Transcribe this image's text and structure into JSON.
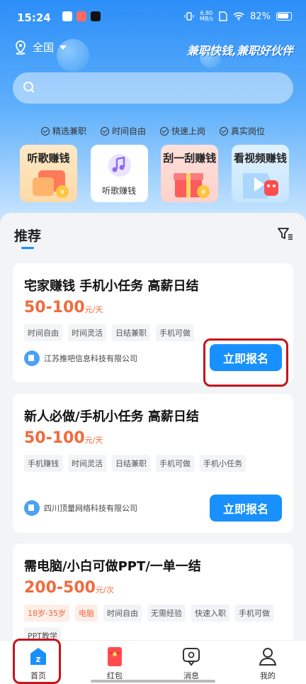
{
  "status_bar": {
    "time": "15:24",
    "speed_value": "6.80",
    "speed_unit": "MB/s",
    "battery": "82%"
  },
  "location": "全国",
  "slogan": "兼职快钱,兼职好伙伴",
  "features": [
    "精选兼职",
    "时间自由",
    "快速上岗",
    "真实岗位"
  ],
  "categories": [
    {
      "label": "听歌赚钱"
    },
    {
      "label": "听歌赚钱"
    },
    {
      "label": "刮一刮赚钱"
    },
    {
      "label": "看视频赚钱"
    }
  ],
  "section_title": "推荐",
  "jobs": [
    {
      "title": "宅家赚钱 手机小任务 高薪日结",
      "salary": "50-100",
      "unit": "元/天",
      "tags": [
        "时间自由",
        "时间灵活",
        "日结兼职",
        "手机可做"
      ],
      "company": "江苏推吧信息科技有限公司",
      "button": "立即报名"
    },
    {
      "title": "新人必做/手机小任务 高薪日结",
      "salary": "50-100",
      "unit": "元/天",
      "tags": [
        "手机赚钱",
        "时间灵活",
        "日结兼职",
        "手机可做",
        "手机小任务"
      ],
      "company": "四川顶量网络科技有限公司",
      "button": "立即报名"
    },
    {
      "title": "需电脑/小白可做PPT/一单一结",
      "salary": "200-500",
      "unit": "元/次",
      "tags": [
        "18岁-35岁",
        "电脑",
        "时间自由",
        "无需经验",
        "快速入职",
        "手机可做",
        "PPT教学"
      ]
    }
  ],
  "tabs": [
    {
      "label": "首页",
      "icon": "home-icon",
      "active": true
    },
    {
      "label": "红包",
      "icon": "red-envelope-icon"
    },
    {
      "label": "消息",
      "icon": "message-icon"
    },
    {
      "label": "我的",
      "icon": "profile-icon"
    }
  ],
  "colors": {
    "accent": "#1890ff",
    "salary": "#f26a3d",
    "highlight_box": "#c4161c"
  }
}
